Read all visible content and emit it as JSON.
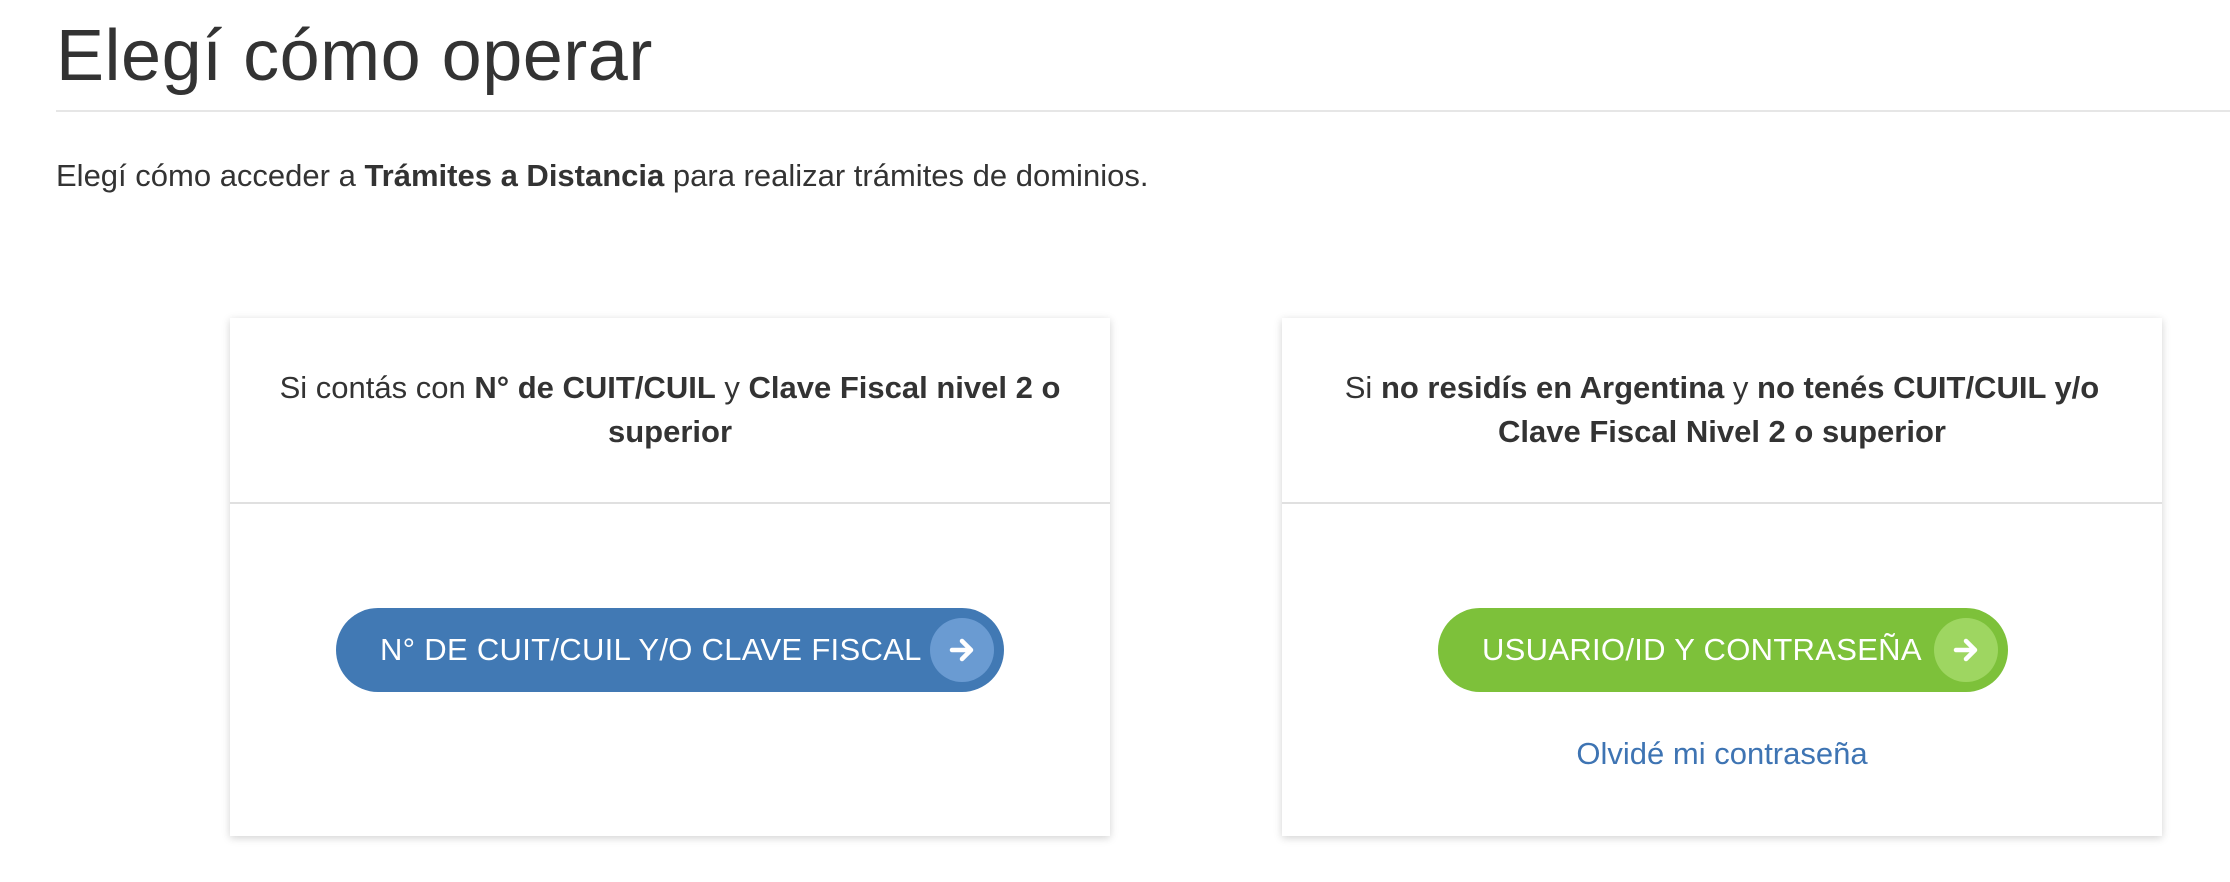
{
  "page": {
    "title": "Elegí cómo operar"
  },
  "intro": {
    "prefix": "Elegí cómo acceder a ",
    "emphasis": "Trámites a Distancia",
    "suffix": " para realizar trámites de dominios."
  },
  "cards": {
    "cuit": {
      "description": {
        "t1": "Si contás con ",
        "b1": "N° de CUIT/CUIL",
        "t2": " y ",
        "b2": "Clave Fiscal nivel 2 o superior"
      },
      "button_label": "N° DE CUIT/CUIL Y/O CLAVE FISCAL",
      "button_icon": "arrow-right-icon"
    },
    "user": {
      "description": {
        "t1": "Si ",
        "b1": "no residís en Argentina",
        "t2": " y ",
        "b2": "no tenés CUIT/CUIL y/o Clave Fiscal Nivel 2 o superior"
      },
      "button_label": "USUARIO/ID Y CONTRASEÑA",
      "button_icon": "arrow-right-icon",
      "forgot_link": "Olvidé mi contraseña"
    }
  },
  "colors": {
    "blue_button": "#4179b4",
    "green_button": "#7dc13a",
    "link": "#3e74b3"
  }
}
